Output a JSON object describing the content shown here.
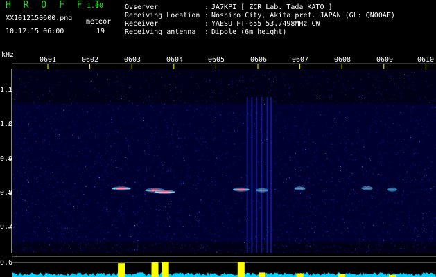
{
  "header": {
    "app_title": "H R O F F T",
    "app_version": "1.00",
    "file_name": "XX1012150600.png",
    "datetime": "10.12.15 06:00",
    "meteor_label": "meteor",
    "meteor_count": "19"
  },
  "info": [
    {
      "label": "Ovserver",
      "value": "JA7KPI [ ZCR Lab. Tada KATO ]"
    },
    {
      "label": "Receiving Location",
      "value": "Noshiro City, Akita pref. JAPAN (GL: QN00AF)"
    },
    {
      "label": "Receiver",
      "value": "YAESU FT-655 53.7498MHz CW"
    },
    {
      "label": "Receiving antenna",
      "value": "Dipole (6m height)"
    }
  ],
  "colors": {
    "title_green": "#22dd22",
    "tick_yellow": "#ffff00",
    "level_cyan": "#00d0ff",
    "level_yellow": "#ffff00",
    "background_noise": "#000060"
  },
  "chart_data": {
    "type": "heatmap",
    "xlabel": "",
    "ylabel": "kHz",
    "x_ticks": [
      "0601",
      "0602",
      "0603",
      "0604",
      "0605",
      "0606",
      "0607",
      "0608",
      "0609",
      "0610"
    ],
    "y_ticks": [
      "1.1",
      "1.0",
      "0.9",
      "0.8",
      "0.7",
      "0.6"
    ],
    "ylim": [
      0.6,
      1.15
    ],
    "meteor_echoes": [
      {
        "minute": 2.75,
        "freq_khz": 0.815,
        "strength": 0.85
      },
      {
        "minute": 3.55,
        "freq_khz": 0.81,
        "strength": 0.9
      },
      {
        "minute": 3.78,
        "freq_khz": 0.805,
        "strength": 0.95
      },
      {
        "minute": 5.6,
        "freq_khz": 0.812,
        "strength": 0.7
      },
      {
        "minute": 6.1,
        "freq_khz": 0.81,
        "strength": 0.4
      },
      {
        "minute": 7.0,
        "freq_khz": 0.815,
        "strength": 0.35
      },
      {
        "minute": 8.6,
        "freq_khz": 0.816,
        "strength": 0.35
      },
      {
        "minute": 9.2,
        "freq_khz": 0.812,
        "strength": 0.25
      }
    ],
    "level_bursts": [
      {
        "minute": 2.75,
        "level": 0.9
      },
      {
        "minute": 3.55,
        "level": 0.95
      },
      {
        "minute": 3.8,
        "level": 1.0
      },
      {
        "minute": 5.6,
        "level": 1.0
      },
      {
        "minute": 6.1,
        "level": 0.3
      },
      {
        "minute": 7.0,
        "level": 0.25
      },
      {
        "minute": 8.0,
        "level": 0.2
      },
      {
        "minute": 9.2,
        "level": 0.15
      }
    ]
  }
}
